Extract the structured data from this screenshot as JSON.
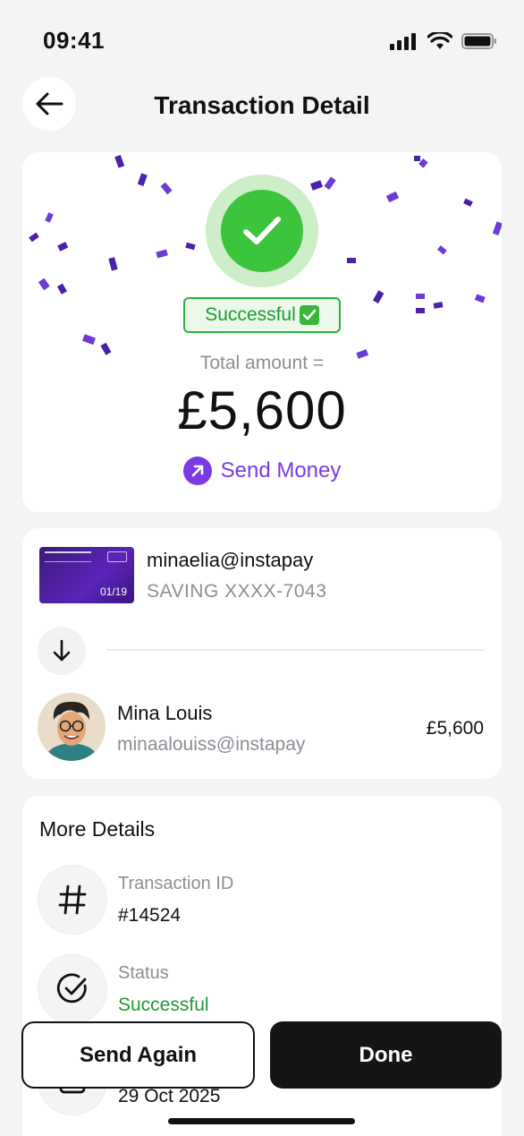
{
  "status_bar": {
    "time": "09:41"
  },
  "header": {
    "title": "Transaction Detail"
  },
  "summary": {
    "status_label": "Successful",
    "total_label": "Total amount =",
    "total_amount": "£5,600",
    "transaction_type": "Send Money",
    "colors": {
      "success": "#3cc43c",
      "accent": "#7a3be6"
    }
  },
  "transfer": {
    "from": {
      "card_date": "01/19",
      "name": "minaelia@instapay",
      "account": "SAVING XXXX-7043"
    },
    "to": {
      "name": "Mina Louis",
      "handle": "minaalouiss@instapay",
      "amount": "£5,600"
    }
  },
  "details": {
    "title": "More Details",
    "rows": [
      {
        "icon": "hash-icon",
        "label": "Transaction ID",
        "value": "#14524"
      },
      {
        "icon": "check-circle-icon",
        "label": "Status",
        "value": "Successful"
      },
      {
        "icon": "calendar-icon",
        "label": "",
        "value": "29 Oct 2025"
      }
    ]
  },
  "actions": {
    "send_again": "Send Again",
    "done": "Done"
  }
}
